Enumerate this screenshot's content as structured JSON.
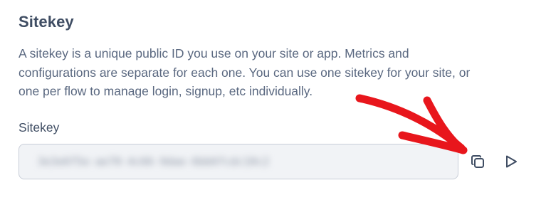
{
  "section": {
    "title": "Sitekey",
    "description": "A sitekey is a unique public ID you use on your site or app. Metrics and configurations are separate for each one. You can use one sitekey for your site, or one per flow to manage login, signup, etc individually."
  },
  "field": {
    "label": "Sitekey",
    "value": "3e3e6f5e-ae70-4c66-9dae-6bb6fcdc10c2",
    "value_blurred": true
  },
  "actions": {
    "copy_icon": "copy-icon",
    "run_icon": "play-icon"
  },
  "colors": {
    "heading": "#3f4d63",
    "body_text": "#5a6880",
    "field_background": "#f1f3f6",
    "field_border": "#c8ced8",
    "icon": "#3f4d63",
    "annotation_arrow": "#e8161c"
  }
}
